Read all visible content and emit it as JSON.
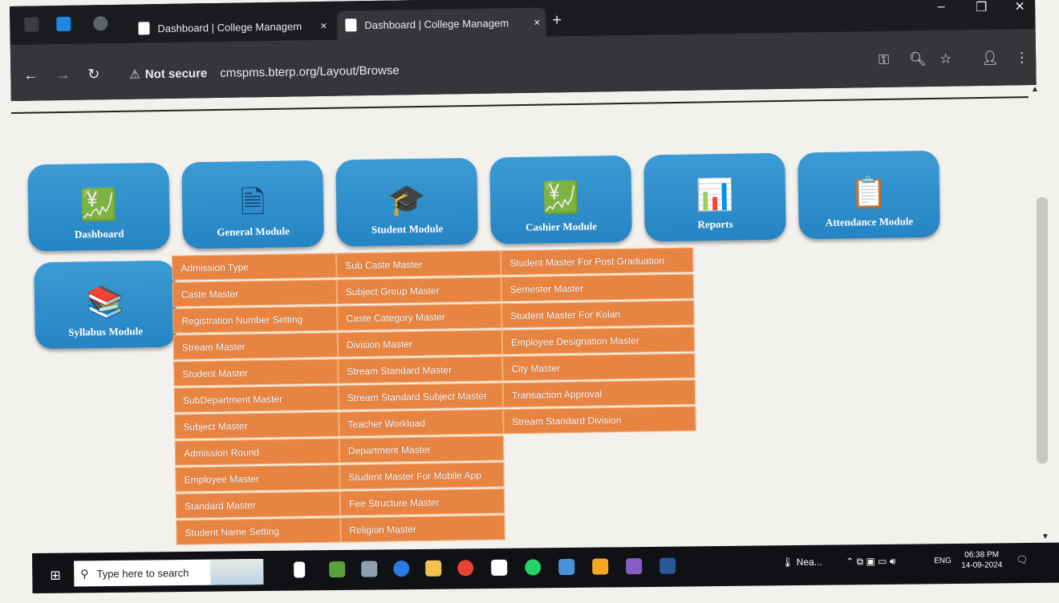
{
  "browser": {
    "tabs": [
      {
        "title": "Dashboard | College Managem",
        "close": "×"
      },
      {
        "title": "Dashboard | College Managem",
        "close": "×"
      }
    ],
    "new_tab": "+",
    "window_controls": {
      "minimize": "–",
      "restore": "❐",
      "close": "✕"
    },
    "nav": {
      "back": "←",
      "forward": "→",
      "reload": "↻"
    },
    "security_label": "Not secure",
    "url": "cmspms.bterp.org/Layout/Browse"
  },
  "modules": [
    {
      "label": "Dashboard",
      "icon": "money-chart-icon"
    },
    {
      "label": "General Module",
      "icon": "document-icon"
    },
    {
      "label": "Student Module",
      "icon": "graduates-icon"
    },
    {
      "label": "Cashier Module",
      "icon": "money-chart-icon"
    },
    {
      "label": "Reports",
      "icon": "report-icon"
    },
    {
      "label": "Attendance Module",
      "icon": "clipboard-icon"
    },
    {
      "label": "Syllabus Module",
      "icon": "books-icon"
    }
  ],
  "general_menu": {
    "col1": [
      "Admission Type",
      "Caste Master",
      "Registration Number Setting",
      "Stream Master",
      "Student Master",
      "SubDepartment Master",
      "Subject Master",
      "Admission Round",
      "Employee Master",
      "Standard Master",
      "Student Name Setting"
    ],
    "col2": [
      "Sub Caste Master",
      "Subject Group Master",
      "Caste Category Master",
      "Division Master",
      "Stream Standard Master",
      "Stream Standard Subject Master",
      "Teacher Workload",
      "Department Master",
      "Student Master For Mobile App",
      "Fee Structure Master",
      "Religion Master"
    ],
    "col3": [
      "Student Master For Post Graduation",
      "Semester Master",
      "Student Master For Kolan",
      "Employee Designation Master",
      "City Master",
      "Transaction Approval",
      "Stream Standard Division"
    ]
  },
  "taskbar": {
    "search_placeholder": "Type here to search",
    "weather": "Nea...",
    "language": "ENG",
    "time": "06:38 PM",
    "date": "14-09-2024"
  }
}
